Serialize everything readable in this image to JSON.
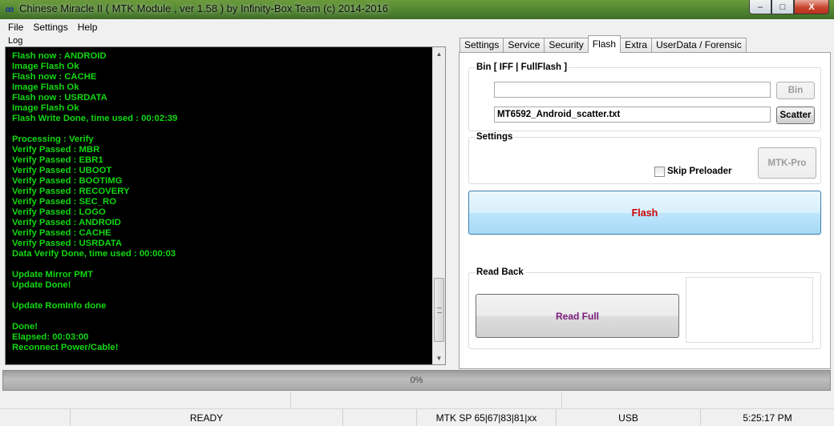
{
  "window": {
    "title": "Chinese Miracle II ( MTK Module , ver 1.58 ) by Infinity-Box Team (c) 2014-2016",
    "min_label": "–",
    "max_label": "□",
    "close_label": "X"
  },
  "menu": [
    "File",
    "Settings",
    "Help"
  ],
  "log": {
    "label": "Log",
    "lines": [
      "Flash now : ANDROID",
      "Image Flash Ok",
      "Flash now : CACHE",
      "Image Flash Ok",
      "Flash now : USRDATA",
      "Image Flash Ok",
      "Flash Write Done, time used : 00:02:39",
      "",
      "Processing : Verify",
      "Verify Passed : MBR",
      "Verify Passed : EBR1",
      "Verify Passed : UBOOT",
      "Verify Passed : BOOTIMG",
      "Verify Passed : RECOVERY",
      "Verify Passed : SEC_RO",
      "Verify Passed : LOGO",
      "Verify Passed : ANDROID",
      "Verify Passed : CACHE",
      "Verify Passed : USRDATA",
      "Data Verify Done, time used : 00:00:03",
      "",
      "Update Mirror PMT",
      "Update Done!",
      "",
      "Update RomInfo done",
      "",
      "Done!",
      "Elapsed: 00:03:00",
      "Reconnect Power/Cable!"
    ]
  },
  "tabs": [
    {
      "label": "Settings",
      "active": false
    },
    {
      "label": "Service",
      "active": false
    },
    {
      "label": "Security",
      "active": false
    },
    {
      "label": "Flash",
      "active": true
    },
    {
      "label": "Extra",
      "active": false
    },
    {
      "label": "UserData / Forensic",
      "active": false
    }
  ],
  "flash_panel": {
    "bin_group_title": "Bin  [ IFF | FullFlash ]",
    "bin_value": "",
    "bin_button": "Bin",
    "scatter_value": "MT6592_Android_scatter.txt",
    "scatter_button": "Scatter",
    "settings_group_title": "Settings",
    "mtkpro_button": "MTK-Pro",
    "skip_preloader_label": "Skip Preloader",
    "skip_preloader_checked": false,
    "flash_button": "Flash",
    "readback_group_title": "Read Back",
    "read_full_button": "Read Full"
  },
  "progress": {
    "text": "0%",
    "value": 0
  },
  "status": {
    "ready": "READY",
    "chip": "MTK SP 65|67|83|81|xx",
    "port": "USB",
    "time": "5:25:17 PM"
  },
  "colors": {
    "log_text": "#11d811",
    "log_bg": "#000000",
    "flash_label": "#cc0000",
    "read_full_label": "#7a1a7a"
  }
}
